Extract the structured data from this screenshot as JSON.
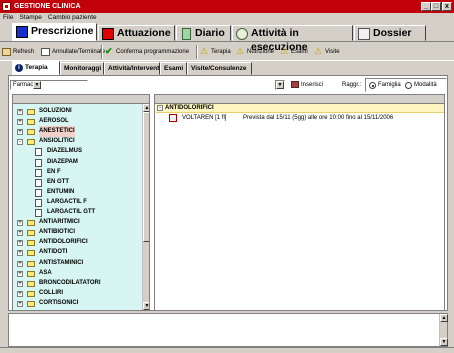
{
  "window": {
    "title": "GESTIONE CLINICA",
    "buttons": [
      "_",
      "□",
      "x"
    ]
  },
  "menu": [
    "File",
    "Stampe",
    "Cambio paziente"
  ],
  "main_tabs": [
    {
      "label": "Prescrizione",
      "icon": "blue-square-icon",
      "active": true
    },
    {
      "label": "Attuazione",
      "icon": "red-square-icon"
    },
    {
      "label": "Diario",
      "icon": "diary-icon"
    },
    {
      "label": "Attività in esecuzione",
      "icon": "clock-icon"
    },
    {
      "label": "Dossier",
      "icon": "dossier-icon"
    }
  ],
  "toolbar": [
    {
      "label": "Refresh",
      "icon": "refresh-icon"
    },
    {
      "label": "Annullate/Terminate",
      "icon": "document-icon"
    },
    {
      "label": "Conferma programmazione",
      "icon": "checkmark-icon"
    },
    {
      "label": "Terapia",
      "icon": "warning-icon"
    },
    {
      "label": "Nutrizione",
      "icon": "warning-icon"
    },
    {
      "label": "Esami",
      "icon": "warning-icon"
    },
    {
      "label": "Visite",
      "icon": "warning-icon"
    }
  ],
  "sub_tabs": [
    "Terapia",
    "Monitoraggi",
    "Attività/Interventi",
    "Esami",
    "Visite/Consulenze"
  ],
  "filter": {
    "combo_value": "Farmaci",
    "insert_label": "Inserisci",
    "group_label": "Raggr.:",
    "radio_famiglia": "Famiglia",
    "radio_modalita": "Modalità"
  },
  "tree": [
    {
      "label": "SOLUZIONI",
      "level": 0,
      "type": "folder",
      "expander": "+"
    },
    {
      "label": "AEROSOL",
      "level": 0,
      "type": "folder",
      "expander": "+"
    },
    {
      "label": "ANESTETICI",
      "level": 0,
      "type": "folder",
      "expander": "+",
      "selected": true
    },
    {
      "label": "ANSIOLITICI",
      "level": 0,
      "type": "folder",
      "expander": "-"
    },
    {
      "label": "DIAZELMUS",
      "level": 1,
      "type": "doc"
    },
    {
      "label": "DIAZEPAM",
      "level": 1,
      "type": "doc"
    },
    {
      "label": "EN F",
      "level": 1,
      "type": "doc"
    },
    {
      "label": "EN GTT",
      "level": 1,
      "type": "doc"
    },
    {
      "label": "ENTUMIN",
      "level": 1,
      "type": "doc"
    },
    {
      "label": "LARGACTIL F",
      "level": 1,
      "type": "doc"
    },
    {
      "label": "LARGACTIL GTT",
      "level": 1,
      "type": "doc"
    },
    {
      "label": "ANTIARITMICI",
      "level": 0,
      "type": "folder",
      "expander": "+"
    },
    {
      "label": "ANTIBIOTICI",
      "level": 0,
      "type": "folder",
      "expander": "+"
    },
    {
      "label": "ANTIDOLORIFICI",
      "level": 0,
      "type": "folder",
      "expander": "+"
    },
    {
      "label": "ANTIDOTI",
      "level": 0,
      "type": "folder",
      "expander": "+"
    },
    {
      "label": "ANTISTAMINICI",
      "level": 0,
      "type": "folder",
      "expander": "+"
    },
    {
      "label": "ASA",
      "level": 0,
      "type": "folder",
      "expander": "+"
    },
    {
      "label": "BRONCODILATATORI",
      "level": 0,
      "type": "folder",
      "expander": "+"
    },
    {
      "label": "COLLIRI",
      "level": 0,
      "type": "folder",
      "expander": "+"
    },
    {
      "label": "CORTISONICI",
      "level": 0,
      "type": "folder",
      "expander": "+"
    }
  ],
  "prescriptions": {
    "group": {
      "expander": "-",
      "label": "ANTIDOLORIFICI"
    },
    "rows": [
      {
        "drug": "VOLTAREN [1 fl]",
        "description": "Prevista dal 15/11 (5gg) alle ore 10:00 fino al 15/11/2006"
      }
    ]
  },
  "colors": {
    "titlebar": "#c1000a",
    "tree_bg": "#d7f5f3",
    "group_row": "#fdf5c0",
    "selected": "#f0d0c8"
  }
}
